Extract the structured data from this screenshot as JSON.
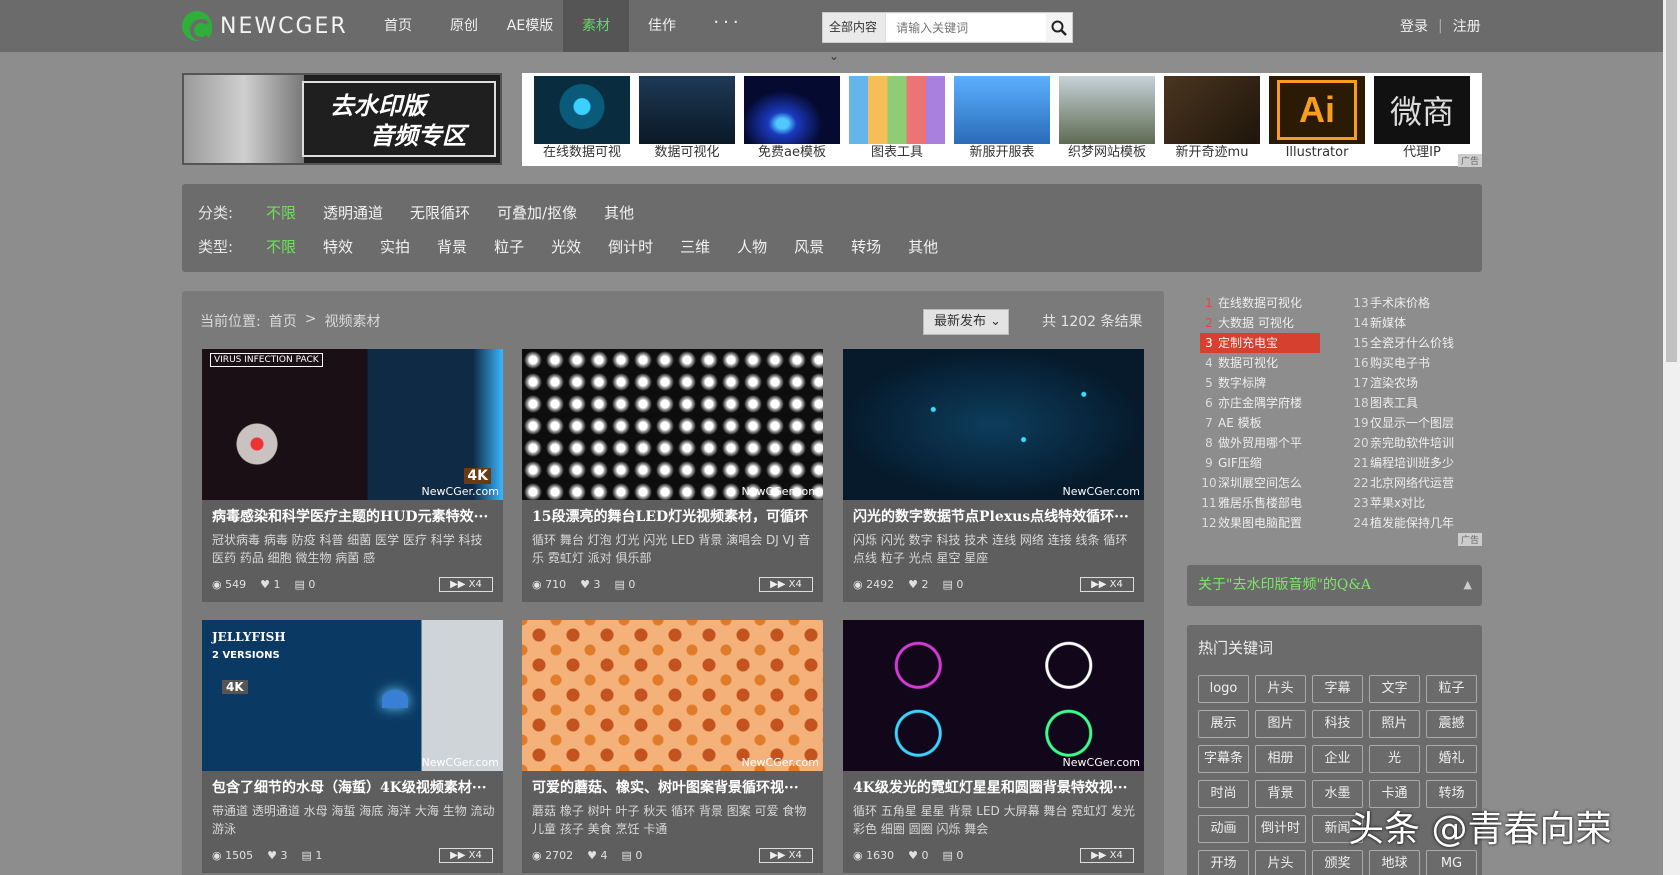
{
  "header": {
    "logo_text": "NEWCGER",
    "nav": [
      "首页",
      "原创",
      "AE模版",
      "素材",
      "佳作"
    ],
    "active_nav": "素材",
    "more": "···",
    "search": {
      "scope": "全部内容",
      "placeholder": "请输入关键词"
    },
    "login": "登录",
    "register": "注册"
  },
  "promo": {
    "line1": "去水印版",
    "line2": "音频专区"
  },
  "ads": {
    "items": [
      "在线数据可视",
      "数据可视化",
      "免费ae模板",
      "图表工具",
      "新服开服表",
      "织梦网站模板",
      "新开奇迹mu",
      "Illustrator",
      "代理IP"
    ],
    "tag": "广告",
    "colors": [
      "#0a2c3f",
      "#122033",
      "#0b1b55",
      "#e9f0f5",
      "#3a8fd0",
      "#6a7a6a",
      "#3b2c1c",
      "#2a1a05",
      "#111111"
    ],
    "ai_text": "Ai",
    "wei_text": "微商"
  },
  "filters": {
    "category_label": "分类:",
    "categories": [
      "不限",
      "透明通道",
      "无限循环",
      "可叠加/抠像",
      "其他"
    ],
    "type_label": "类型:",
    "types": [
      "不限",
      "特效",
      "实拍",
      "背景",
      "粒子",
      "光效",
      "倒计时",
      "三维",
      "人物",
      "风景",
      "转场",
      "其他"
    ],
    "selected": "不限"
  },
  "main": {
    "crumb_label": "当前位置:",
    "crumb_home": "首页",
    "crumb_sep": ">",
    "crumb_current": "视频素材",
    "sort": "最新发布",
    "total": "共 1202 条结果"
  },
  "cards": [
    {
      "title": "病毒感染和科学医疗主题的HUD元素特效···",
      "tags": "冠状病毒 病毒 防疫 科普 细菌 医学 医疗 科学 科技 医药 药品 细胞 微生物 病菌 感",
      "views": "549",
      "likes": "1",
      "comments": "0",
      "thumb_color": "#1a0f14",
      "watermark": "NewCGer.com",
      "badge_top": "VIRUS INFECTION PACK",
      "badge_4k": "4K"
    },
    {
      "title": "15段漂亮的舞台LED灯光视频素材，可循环",
      "tags": "循环 舞台 灯泡 灯光 闪光 LED 背景 演唱会 DJ VJ 音乐 霓虹灯 派对 俱乐部",
      "views": "710",
      "likes": "3",
      "comments": "0",
      "thumb_color": "#0d0d0d",
      "watermark": "NewCGer.com"
    },
    {
      "title": "闪光的数字数据节点Plexus点线特效循环···",
      "tags": "闪烁 闪光 数字 科技 技术 连线 网络 连接 线条 循环 点线 粒子 光点 星空 星座",
      "views": "2492",
      "likes": "2",
      "comments": "0",
      "thumb_color": "#061a2c",
      "watermark": "NewCGer.com"
    },
    {
      "title": "包含了细节的水母（海蜇）4K级视频素材···",
      "tags": "带通道 透明通道 水母 海蜇 海底 海洋 大海 生物 流动 游泳",
      "views": "1505",
      "likes": "3",
      "comments": "1",
      "thumb_color": "#0a3a63",
      "watermark": "NewCGer.com",
      "badge_top": "JELLYFISH",
      "badge_sub": "2 VERSIONS",
      "badge_4k": "4K"
    },
    {
      "title": "可爱的蘑菇、橡实、树叶图案背景循环视···",
      "tags": "蘑菇 橡子 树叶 叶子 秋天 循环 背景 图案 可爱 食物 儿童 孩子 美食 烹饪 卡通",
      "views": "2702",
      "likes": "4",
      "comments": "0",
      "thumb_color": "#f4b27a",
      "watermark": "NewCGer.com"
    },
    {
      "title": "4K级发光的霓虹灯星星和圆圈背景特效视···",
      "tags": "循环 五角星 星星 背景 LED 大屏幕 舞台 霓虹灯 发光 彩色 细圈 圆圈 闪烁 舞会",
      "views": "1630",
      "likes": "0",
      "comments": "0",
      "thumb_color": "#12061a",
      "watermark": "NewCGer.com"
    }
  ],
  "card_badge": "X4",
  "ranking": {
    "left": [
      {
        "n": "1",
        "t": "在线数据可视化"
      },
      {
        "n": "2",
        "t": "大数据 可视化"
      },
      {
        "n": "3",
        "t": "定制充电宝"
      },
      {
        "n": "4",
        "t": "数据可视化"
      },
      {
        "n": "5",
        "t": "数字标牌"
      },
      {
        "n": "6",
        "t": "亦庄金隅学府楼"
      },
      {
        "n": "7",
        "t": "AE 模板"
      },
      {
        "n": "8",
        "t": "做外贸用哪个平"
      },
      {
        "n": "9",
        "t": "GIF压缩"
      },
      {
        "n": "10",
        "t": "深圳展空间怎么"
      },
      {
        "n": "11",
        "t": "雅居乐售楼部电"
      },
      {
        "n": "12",
        "t": "效果图电脑配置"
      }
    ],
    "right": [
      {
        "n": "13",
        "t": "手术床价格"
      },
      {
        "n": "14",
        "t": "新媒体"
      },
      {
        "n": "15",
        "t": "全瓷牙什么价钱"
      },
      {
        "n": "16",
        "t": "购买电子书"
      },
      {
        "n": "17",
        "t": "渲染农场"
      },
      {
        "n": "18",
        "t": "图表工具"
      },
      {
        "n": "19",
        "t": "仅显示一个图层"
      },
      {
        "n": "20",
        "t": "亲完助软件培训"
      },
      {
        "n": "21",
        "t": "编程培训班多少"
      },
      {
        "n": "22",
        "t": "北京网络代运营"
      },
      {
        "n": "23",
        "t": "苹果x对比"
      },
      {
        "n": "24",
        "t": "植发能保持几年"
      }
    ],
    "hot_index": 2,
    "tag": "广告"
  },
  "qa": "关于\"去水印版音频\"的Q&A",
  "hot_keywords": {
    "title": "热门关键词",
    "items": [
      "logo",
      "片头",
      "字幕",
      "文字",
      "粒子",
      "展示",
      "图片",
      "科技",
      "照片",
      "震撼",
      "字幕条",
      "相册",
      "企业",
      "光",
      "婚礼",
      "时尚",
      "背景",
      "水墨",
      "卡通",
      "转场",
      "动画",
      "倒计时",
      "新闻",
      "",
      "",
      "开场",
      "片头",
      "颁奖",
      "地球",
      "MG"
    ]
  },
  "overlay_watermark": "头条 @青春向荣"
}
